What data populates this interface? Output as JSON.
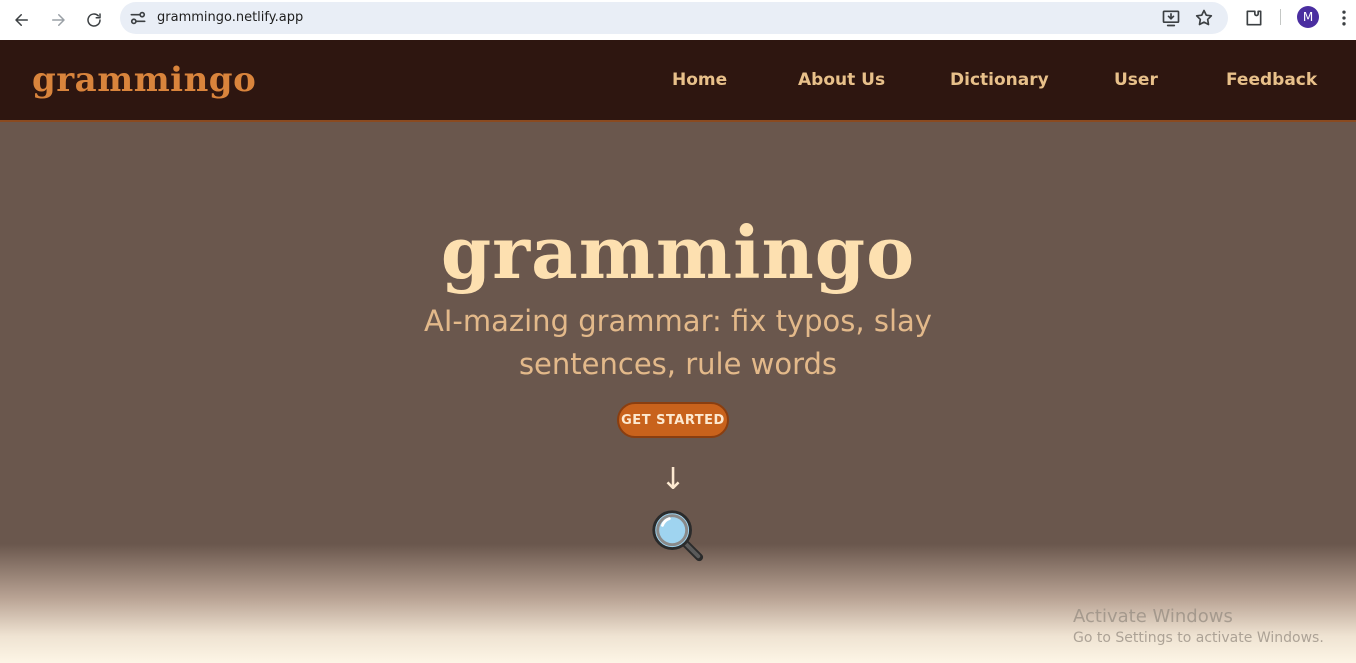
{
  "browser": {
    "url": "grammingo.netlify.app",
    "profile_initial": "M",
    "icons": [
      "back-icon",
      "forward-icon",
      "reload-icon",
      "site-info-icon",
      "install-app-icon",
      "bookmark-star-icon",
      "extensions-icon",
      "menu-kebab-icon"
    ]
  },
  "site": {
    "logo": "grammingo",
    "nav": [
      {
        "label": "Home"
      },
      {
        "label": "About Us"
      },
      {
        "label": "Dictionary"
      },
      {
        "label": "User"
      },
      {
        "label": "Feedback"
      }
    ]
  },
  "hero": {
    "title": "grammingo",
    "subtitle": "AI-mazing grammar: fix typos, slay sentences, rule words",
    "cta_label": "GET STARTED",
    "arrow": "↓",
    "icon": "magnifier-icon"
  },
  "watermark": {
    "line1": "Activate Windows",
    "line2": "Go to Settings to activate Windows."
  },
  "colors": {
    "header_bg": "#2e1610",
    "logo": "#d9843c",
    "nav_text": "#e8c08a",
    "hero_bg": "#6a574d",
    "hero_title": "#fde0b0",
    "hero_subtitle": "#e3b98a",
    "cta_bg": "#c8621c"
  }
}
